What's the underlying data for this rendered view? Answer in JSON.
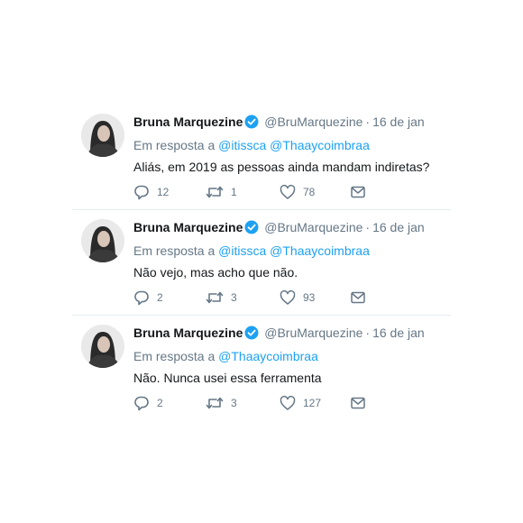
{
  "tweets": [
    {
      "name": "Bruna Marquezine",
      "handle": "@BruMarquezine",
      "separator": "·",
      "date": "16 de jan",
      "reply_prefix": "Em resposta a",
      "mentions": [
        "@itissca",
        "@Thaaycoimbraa"
      ],
      "text": "Aliás, em 2019 as pessoas ainda mandam indiretas?",
      "replies": "12",
      "retweets": "1",
      "likes": "78"
    },
    {
      "name": "Bruna Marquezine",
      "handle": "@BruMarquezine",
      "separator": "·",
      "date": "16 de jan",
      "reply_prefix": "Em resposta a",
      "mentions": [
        "@itissca",
        "@Thaaycoimbraa"
      ],
      "text": "Não vejo, mas acho que não.",
      "replies": "2",
      "retweets": "3",
      "likes": "93"
    },
    {
      "name": "Bruna Marquezine",
      "handle": "@BruMarquezine",
      "separator": "·",
      "date": "16 de jan",
      "reply_prefix": "Em resposta a",
      "mentions": [
        "@Thaaycoimbraa"
      ],
      "text": "Não. Nunca usei essa ferramenta",
      "replies": "2",
      "retweets": "3",
      "likes": "127"
    }
  ],
  "icons": {
    "verified": "verified-badge-icon",
    "reply": "reply-icon",
    "retweet": "retweet-icon",
    "like": "heart-icon",
    "dm": "envelope-icon"
  },
  "colors": {
    "text": "#14171a",
    "secondary": "#657786",
    "link": "#1da1f2",
    "verified": "#1da1f2",
    "divider": "#e6ecf0"
  }
}
